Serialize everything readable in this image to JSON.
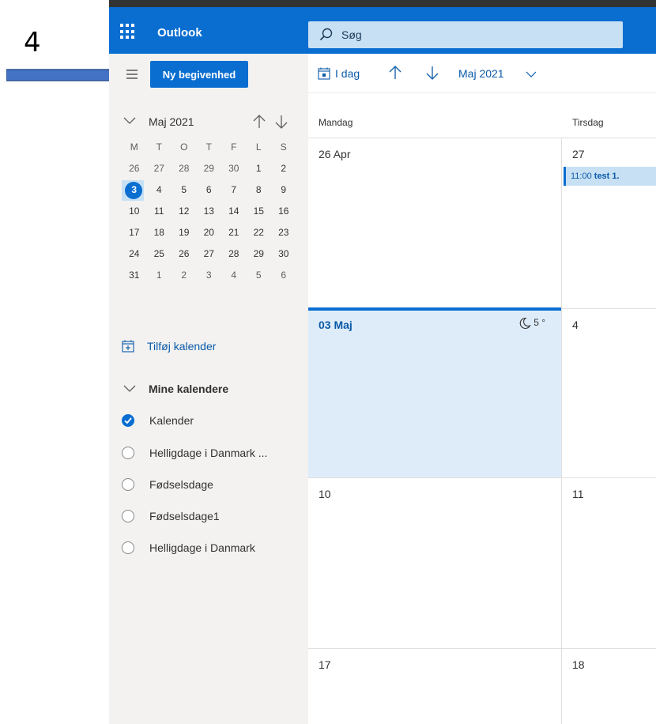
{
  "annotation": {
    "step_number": "4"
  },
  "header": {
    "app_name": "Outlook",
    "search_placeholder": "Søg"
  },
  "leftpane": {
    "new_event_label": "Ny begivenhed",
    "minical": {
      "month_label": "Maj 2021",
      "weekday_headers": [
        "M",
        "T",
        "O",
        "T",
        "F",
        "L",
        "S"
      ],
      "weeks": [
        [
          "26",
          "27",
          "28",
          "29",
          "30",
          "1",
          "2"
        ],
        [
          "3",
          "4",
          "5",
          "6",
          "7",
          "8",
          "9"
        ],
        [
          "10",
          "11",
          "12",
          "13",
          "14",
          "15",
          "16"
        ],
        [
          "17",
          "18",
          "19",
          "20",
          "21",
          "22",
          "23"
        ],
        [
          "24",
          "25",
          "26",
          "27",
          "28",
          "29",
          "30"
        ],
        [
          "31",
          "1",
          "2",
          "3",
          "4",
          "5",
          "6"
        ]
      ],
      "today": "3"
    },
    "add_calendar_label": "Tilføj kalender",
    "my_calendars_label": "Mine kalendere",
    "calendars": [
      {
        "label": "Kalender",
        "checked": true
      },
      {
        "label": "Helligdage i Danmark ...",
        "checked": false
      },
      {
        "label": "Fødselsdage",
        "checked": false
      },
      {
        "label": "Fødselsdage1",
        "checked": false
      },
      {
        "label": "Helligdage i Danmark",
        "checked": false
      }
    ]
  },
  "toolbar": {
    "today_label": "I dag",
    "month_label": "Maj 2021"
  },
  "grid": {
    "columns": [
      "Mandag",
      "Tirsdag"
    ],
    "weeks": [
      {
        "days": [
          "26 Apr",
          "27"
        ]
      },
      {
        "days": [
          "03 Maj",
          "4"
        ]
      },
      {
        "days": [
          "10",
          "11"
        ]
      },
      {
        "days": [
          "17",
          "18"
        ]
      }
    ],
    "event": {
      "time": "11:00",
      "title": "test 1."
    },
    "weather": "5 °"
  },
  "colors": {
    "brand_blue": "#0a6ed1",
    "search_bg": "#c7e0f4",
    "today_bg": "#deecf9"
  }
}
